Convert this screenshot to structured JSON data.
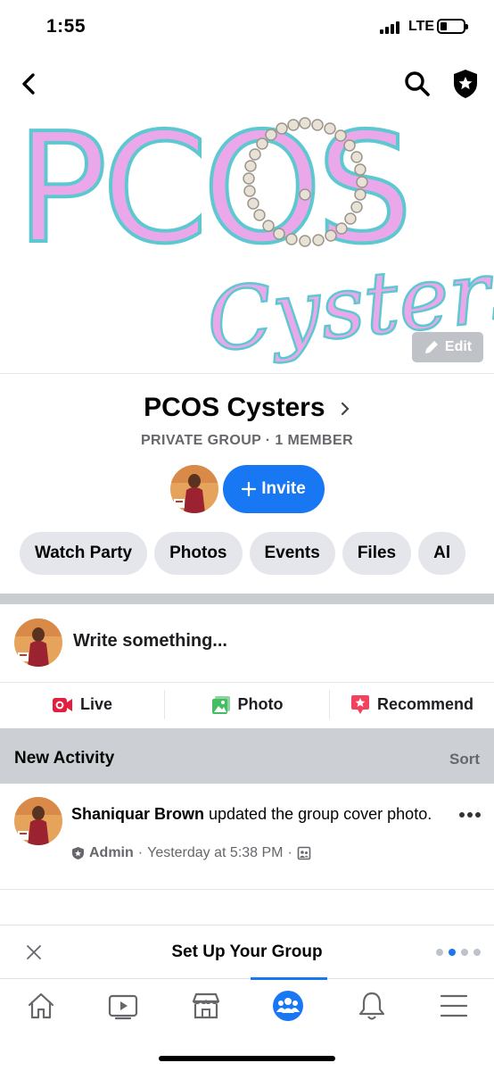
{
  "status": {
    "time": "1:55",
    "network": "LTE"
  },
  "cover": {
    "logo_text": "PCOS",
    "logo_script": "Cysters",
    "edit_label": "Edit"
  },
  "group": {
    "name": "PCOS Cysters",
    "meta": "PRIVATE GROUP · 1 MEMBER",
    "invite_label": "Invite"
  },
  "tabs": [
    {
      "label": "Watch Party"
    },
    {
      "label": "Photos"
    },
    {
      "label": "Events"
    },
    {
      "label": "Files"
    },
    {
      "label": "Al"
    }
  ],
  "composer": {
    "placeholder": "Write something..."
  },
  "actions": {
    "live": "Live",
    "photo": "Photo",
    "recommend": "Recommend"
  },
  "activity": {
    "title": "New Activity",
    "sort": "Sort"
  },
  "post": {
    "author": "Shaniquar Brown",
    "action_text": " updated the group cover photo.",
    "role": "Admin",
    "time": "Yesterday at 5:38 PM"
  },
  "setup": {
    "title": "Set Up Your Group"
  },
  "colors": {
    "accent": "#1877f2",
    "logo_pink": "#eaa8ea",
    "logo_teal": "#5ec8d0",
    "live_red": "#e41e3f",
    "photo_green": "#45bd62",
    "recommend_red": "#f3425f"
  },
  "icons": {
    "back": "chevron-left-icon",
    "search": "search-icon",
    "shield": "admin-shield-icon",
    "home": "home-icon",
    "watch": "video-icon",
    "marketplace": "marketplace-icon",
    "groups": "groups-icon",
    "notifications": "bell-icon",
    "menu": "menu-icon"
  }
}
